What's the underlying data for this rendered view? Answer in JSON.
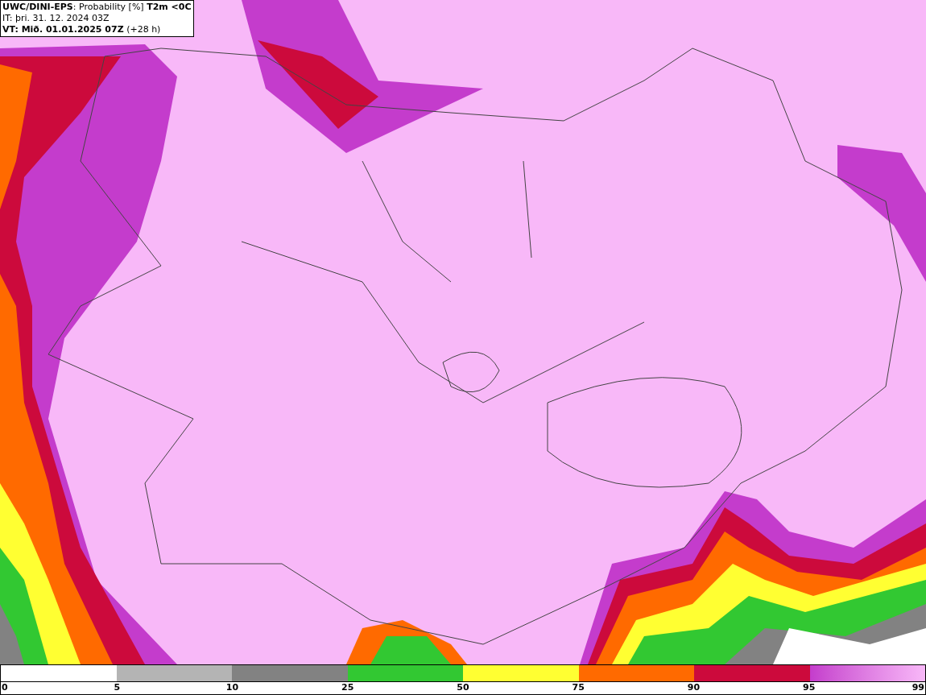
{
  "header": {
    "lines": [
      "**UWC/DINI-EPS**: Probability [%] **T2m <0C**",
      "IT: þri. 31. 12. 2024 03Z",
      "**VT: Mið. 01.01.2025 07Z** (+28 h)"
    ]
  },
  "legend": {
    "start": "0",
    "bins": [
      {
        "to": "5",
        "color": "#ffffff"
      },
      {
        "to": "10",
        "color": "#b4b4b4"
      },
      {
        "to": "25",
        "color": "#828282"
      },
      {
        "to": "50",
        "color": "#32c832"
      },
      {
        "to": "75",
        "color": "#ffff32"
      },
      {
        "to": "90",
        "color": "#ff6a00"
      },
      {
        "to": "95",
        "color": "#cc0a3c"
      },
      {
        "to": "99",
        "kind": "gradient"
      }
    ]
  }
}
